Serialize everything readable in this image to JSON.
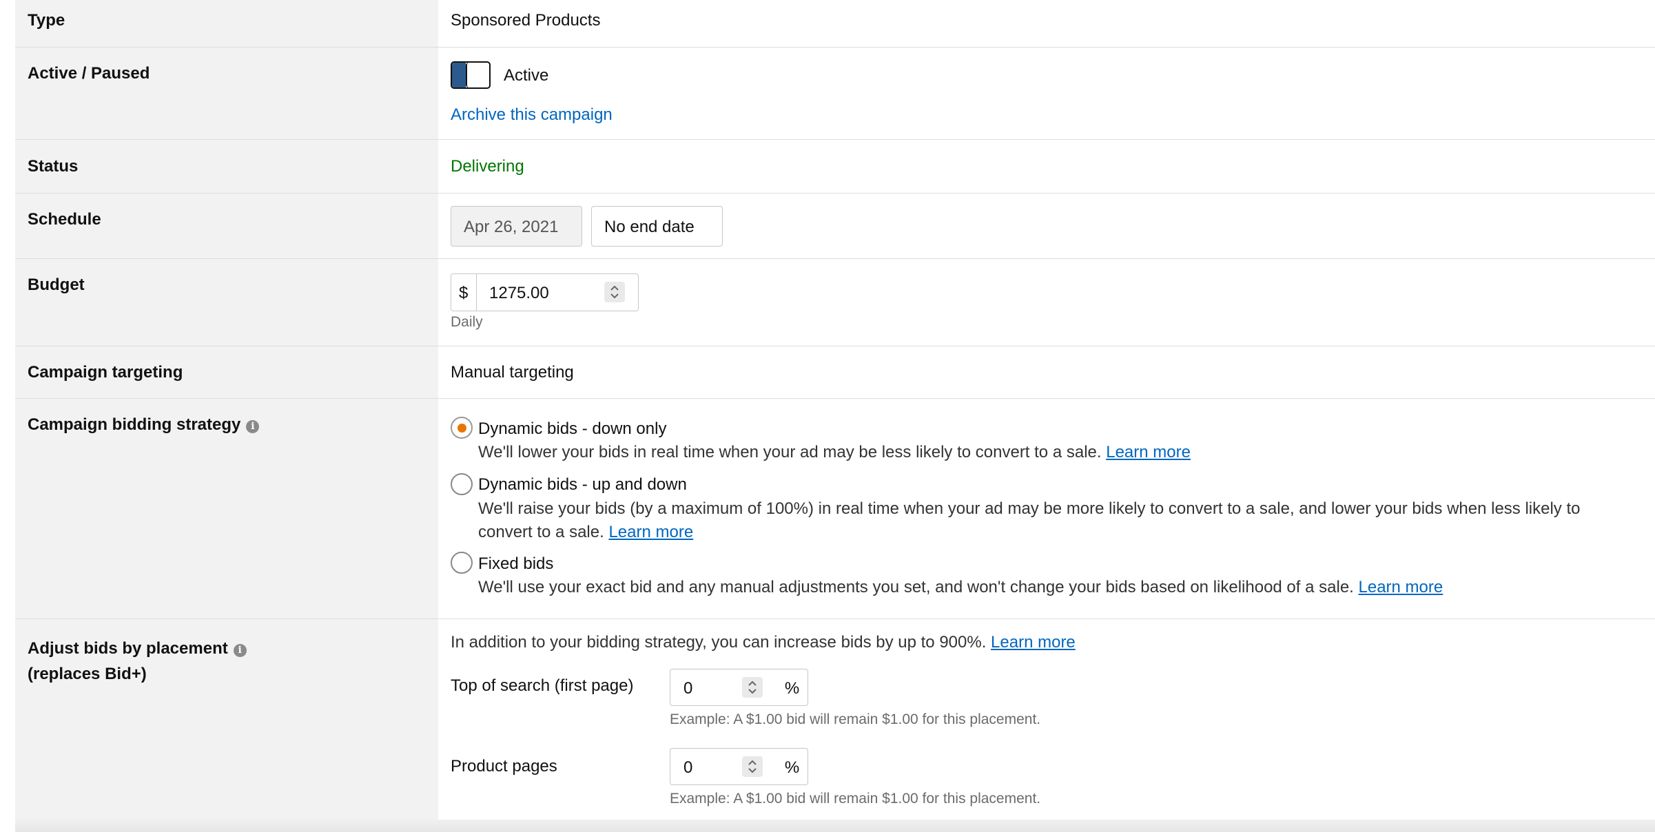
{
  "rows": {
    "type": {
      "label": "Type",
      "value": "Sponsored Products"
    },
    "active": {
      "label": "Active / Paused",
      "toggle_state": "Active",
      "archive_link": "Archive this campaign"
    },
    "status": {
      "label": "Status",
      "value": "Delivering",
      "color": "#007600"
    },
    "schedule": {
      "label": "Schedule",
      "start_date": "Apr 26, 2021",
      "end_date": "No end date"
    },
    "budget": {
      "label": "Budget",
      "currency": "$",
      "amount": "1275.00",
      "period": "Daily"
    },
    "targeting": {
      "label": "Campaign targeting",
      "value": "Manual targeting"
    },
    "bidding": {
      "label": "Campaign bidding strategy",
      "options": [
        {
          "title": "Dynamic bids - down only",
          "desc": "We'll lower your bids in real time when your ad may be less likely to convert to a sale.",
          "link": "Learn more",
          "selected": true
        },
        {
          "title": "Dynamic bids - up and down",
          "desc": "We'll raise your bids (by a maximum of 100%) in real time when your ad may be more likely to convert to a sale, and lower your bids when less likely to convert to a sale.",
          "link": "Learn more",
          "selected": false
        },
        {
          "title": "Fixed bids",
          "desc": "We'll use your exact bid and any manual adjustments you set, and won't change your bids based on likelihood of a sale.",
          "link": "Learn more",
          "selected": false
        }
      ]
    },
    "placement": {
      "label_line1": "Adjust bids by placement",
      "label_line2": "(replaces Bid+)",
      "intro": "In addition to your bidding strategy, you can increase bids by up to 900%.",
      "intro_link": "Learn more",
      "items": [
        {
          "label": "Top of search (first page)",
          "value": "0",
          "suffix": "%",
          "example": "Example: A $1.00 bid will remain $1.00 for this placement."
        },
        {
          "label": "Product pages",
          "value": "0",
          "suffix": "%",
          "example": "Example: A $1.00 bid will remain $1.00 for this placement."
        }
      ]
    }
  },
  "colors": {
    "accent_link": "#0066c0",
    "radio_selected": "#e77600",
    "toggle_on": "#2c5a8c"
  }
}
